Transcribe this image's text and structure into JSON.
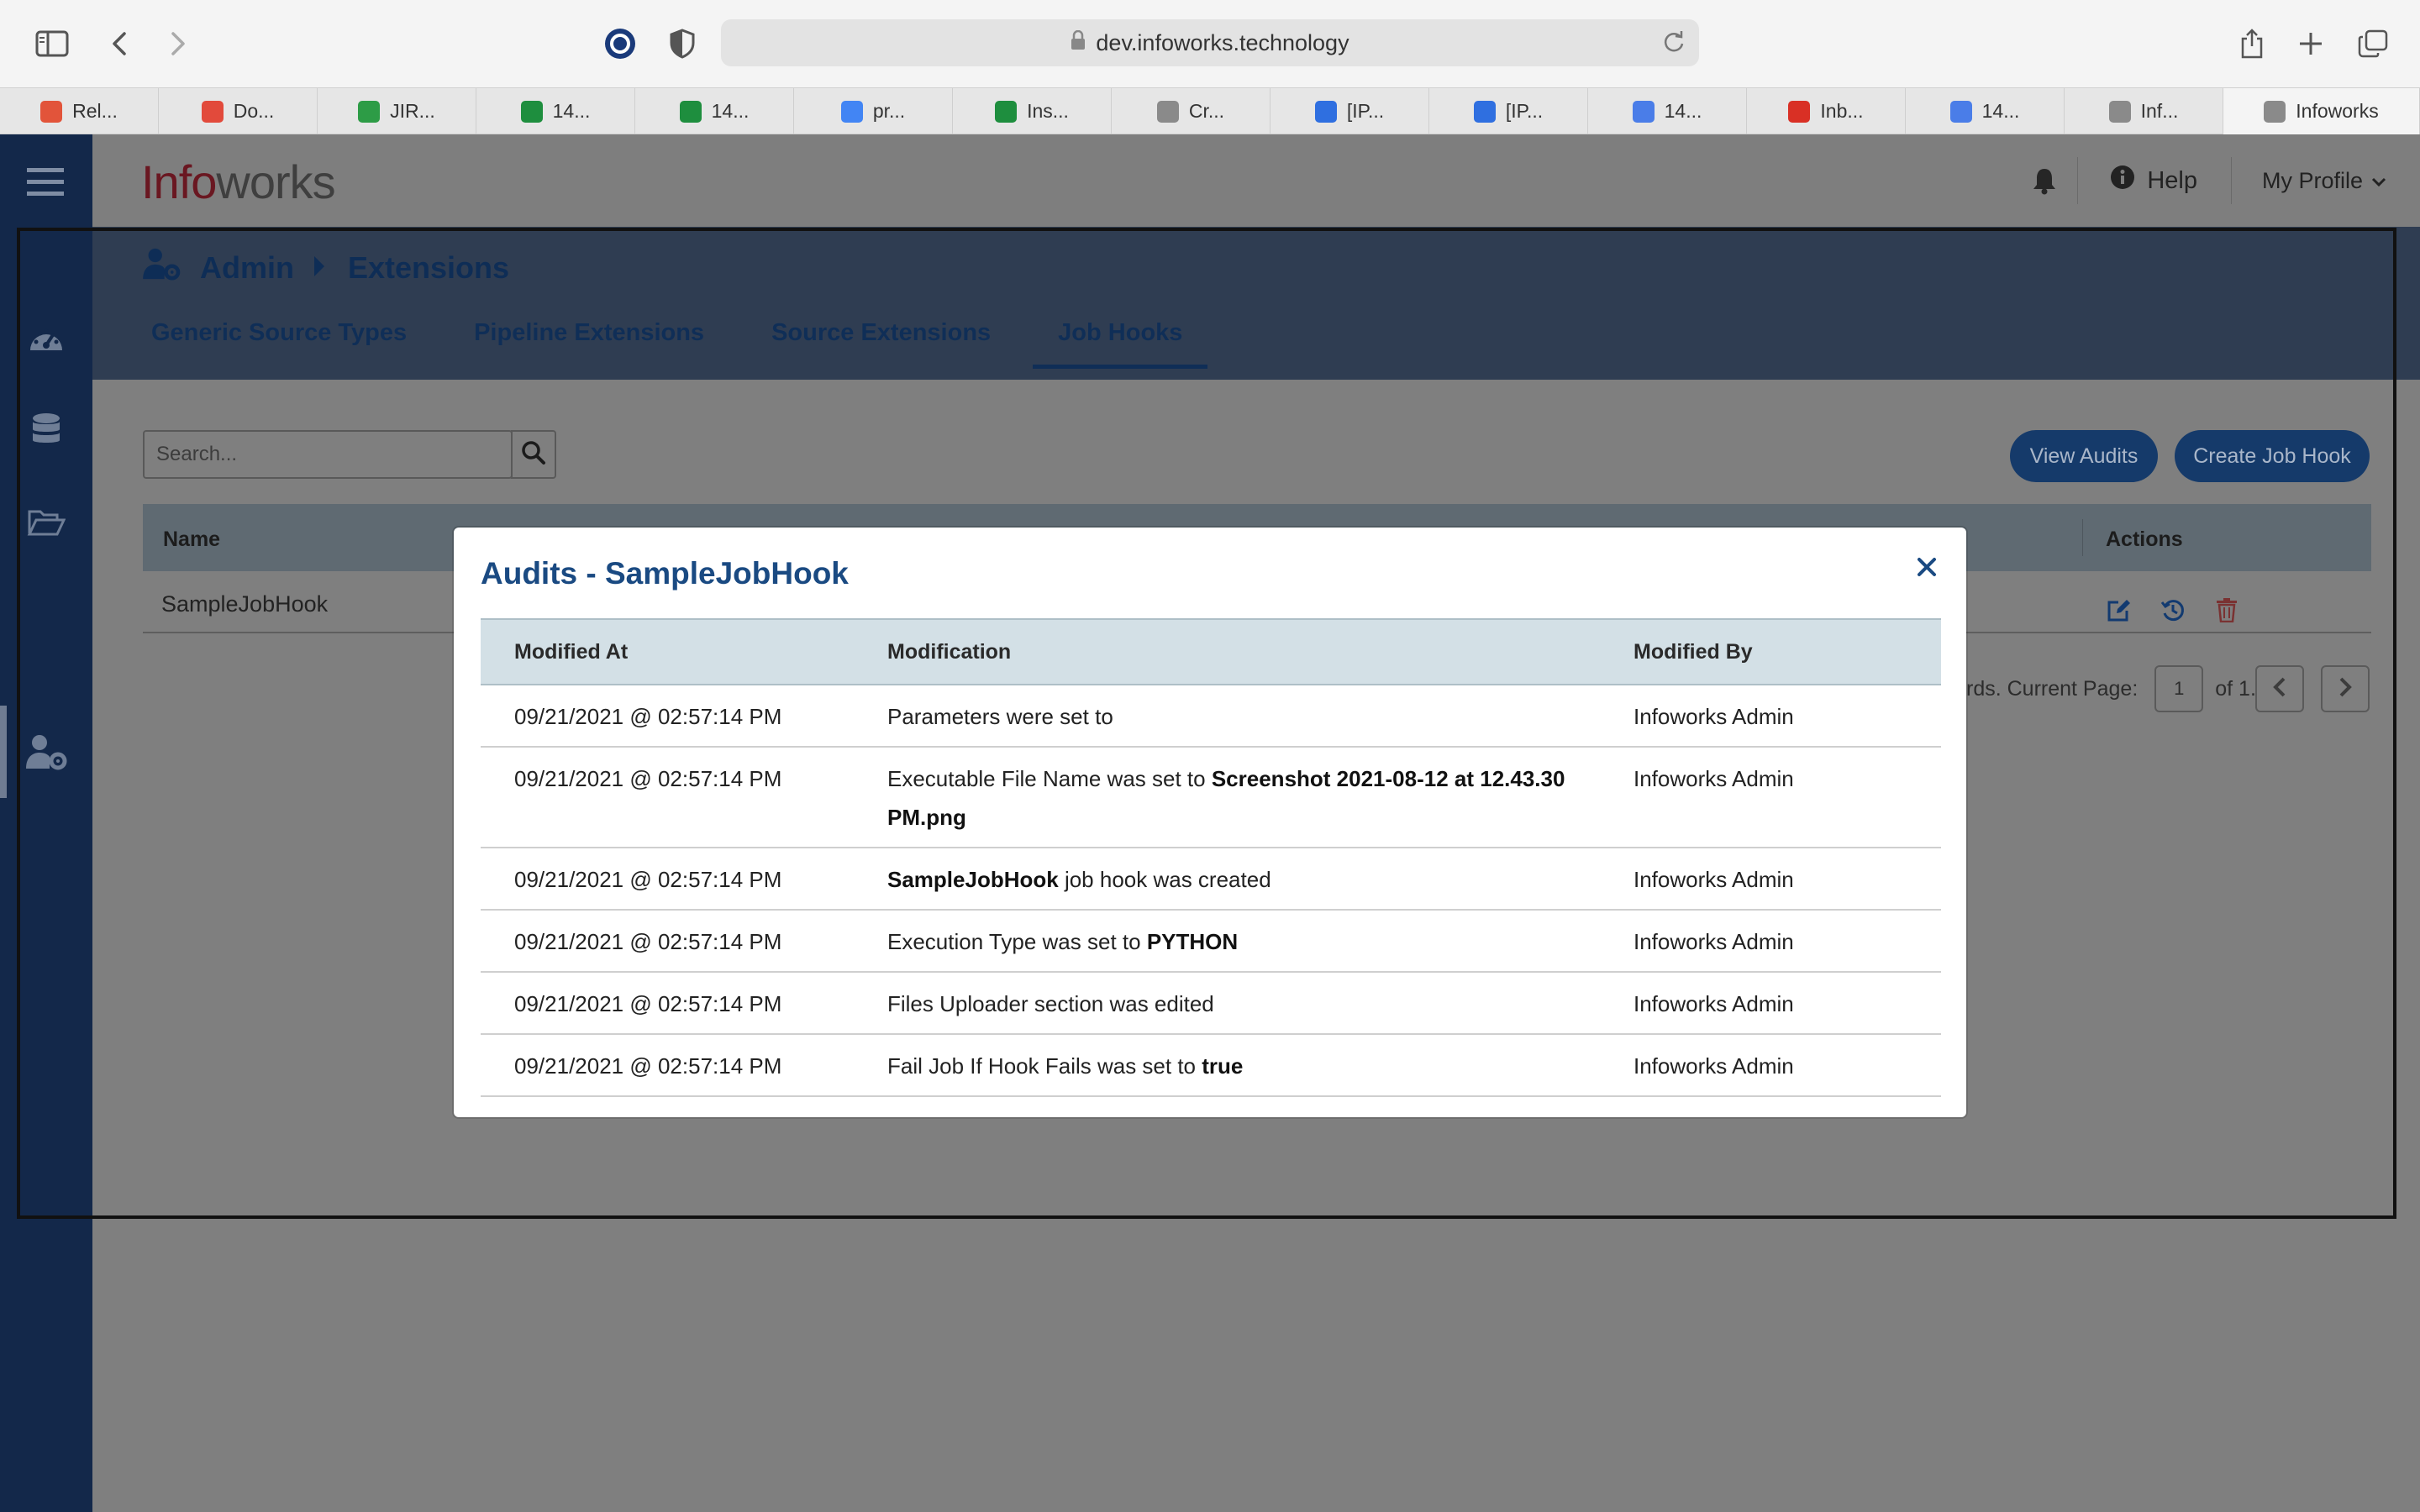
{
  "browser": {
    "url": "dev.infoworks.technology",
    "tabs": [
      {
        "label": "Rel...",
        "icon": "spiral-favicon",
        "color": "#e2543a"
      },
      {
        "label": "Do...",
        "icon": "docs-favicon",
        "color": "#e24a3b"
      },
      {
        "label": "JIR...",
        "icon": "drive-favicon",
        "color": "#2d9c46"
      },
      {
        "label": "14...",
        "icon": "sheets-favicon",
        "color": "#1e8e3e"
      },
      {
        "label": "14...",
        "icon": "sheets-favicon",
        "color": "#1e8e3e"
      },
      {
        "label": "pr...",
        "icon": "google-favicon",
        "color": "#4285f4"
      },
      {
        "label": "Ins...",
        "icon": "sheets-favicon",
        "color": "#1e8e3e"
      },
      {
        "label": "Cr...",
        "icon": "infoworks-favicon",
        "color": "#8a8a8a"
      },
      {
        "label": "[IP...",
        "icon": "jira-favicon",
        "color": "#2f6fe0"
      },
      {
        "label": "[IP...",
        "icon": "jira-favicon",
        "color": "#2f6fe0"
      },
      {
        "label": "14...",
        "icon": "docs-favicon",
        "color": "#4a7de8"
      },
      {
        "label": "Inb...",
        "icon": "gmail-favicon",
        "color": "#d93025"
      },
      {
        "label": "14...",
        "icon": "docs-favicon",
        "color": "#4a7de8"
      },
      {
        "label": "Inf...",
        "icon": "infoworks-favicon",
        "color": "#8a8a8a"
      },
      {
        "label": "Infoworks",
        "icon": "infoworks-favicon",
        "color": "#8a8a8a",
        "active": true
      }
    ]
  },
  "app": {
    "logo_part1": "Info",
    "logo_part2": "works",
    "header": {
      "help": "Help",
      "profile": "My Profile"
    },
    "breadcrumb": {
      "root": "Admin",
      "current": "Extensions"
    },
    "tabs": [
      {
        "label": "Generic Source Types"
      },
      {
        "label": "Pipeline Extensions"
      },
      {
        "label": "Source Extensions"
      },
      {
        "label": "Job Hooks",
        "active": true
      }
    ],
    "search_placeholder": "Search...",
    "buttons": {
      "view_audits": "View Audits",
      "create_job_hook": "Create Job Hook"
    },
    "table": {
      "col_name": "Name",
      "col_actions": "Actions",
      "rows": [
        {
          "name": "SampleJobHook"
        }
      ]
    },
    "pagination": {
      "prefix": "rds. Current Page:",
      "page": "1",
      "suffix": "of 1."
    }
  },
  "modal": {
    "title": "Audits - SampleJobHook",
    "columns": [
      "Modified At",
      "Modification",
      "Modified By"
    ],
    "rows": [
      {
        "at": "09/21/2021 @ 02:57:14 PM",
        "pre": "Parameters were set to",
        "bold": "",
        "post": "",
        "by": "Infoworks Admin"
      },
      {
        "at": "09/21/2021 @ 02:57:14 PM",
        "pre": "Executable File Name was set to ",
        "bold": "Screenshot 2021-08-12 at 12.43.30 PM.png",
        "post": "",
        "by": "Infoworks Admin"
      },
      {
        "at": "09/21/2021 @ 02:57:14 PM",
        "pre": "",
        "bold": "SampleJobHook",
        "post": " job hook was created",
        "by": "Infoworks Admin"
      },
      {
        "at": "09/21/2021 @ 02:57:14 PM",
        "pre": "Execution Type was set to ",
        "bold": "PYTHON",
        "post": "",
        "by": "Infoworks Admin"
      },
      {
        "at": "09/21/2021 @ 02:57:14 PM",
        "pre": "Files Uploader section was edited",
        "bold": "",
        "post": "",
        "by": "Infoworks Admin"
      },
      {
        "at": "09/21/2021 @ 02:57:14 PM",
        "pre": "Fail Job If Hook Fails was set to ",
        "bold": "true",
        "post": "",
        "by": "Infoworks Admin"
      }
    ]
  },
  "colors": {
    "nav_bg": "#13284a",
    "brand_blue": "#1a4a82",
    "logo_red": "#6a1721",
    "delete_red": "#c0392b"
  }
}
